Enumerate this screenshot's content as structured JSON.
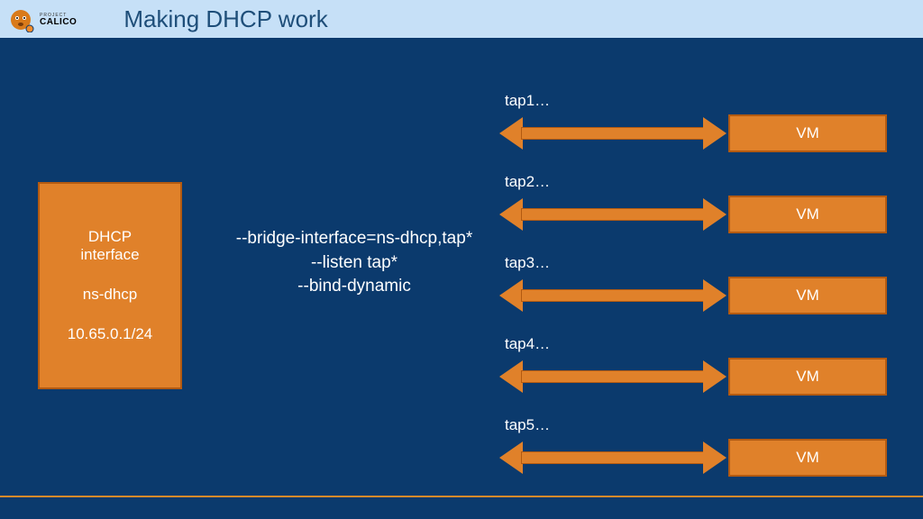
{
  "header": {
    "brand_top": "PROJECT",
    "brand": "CALICO",
    "title": "Making DHCP work"
  },
  "dhcp": {
    "line1": "DHCP",
    "line2": "interface",
    "line3": "ns-dhcp",
    "line4": "10.65.0.1/24"
  },
  "config": {
    "line1": "--bridge-interface=ns-dhcp,tap*",
    "line2": "--listen tap*",
    "line3": "--bind-dynamic"
  },
  "taps": [
    {
      "label": "tap1…",
      "vm": "VM"
    },
    {
      "label": "tap2…",
      "vm": "VM"
    },
    {
      "label": "tap3…",
      "vm": "VM"
    },
    {
      "label": "tap4…",
      "vm": "VM"
    },
    {
      "label": "tap5…",
      "vm": "VM"
    }
  ]
}
